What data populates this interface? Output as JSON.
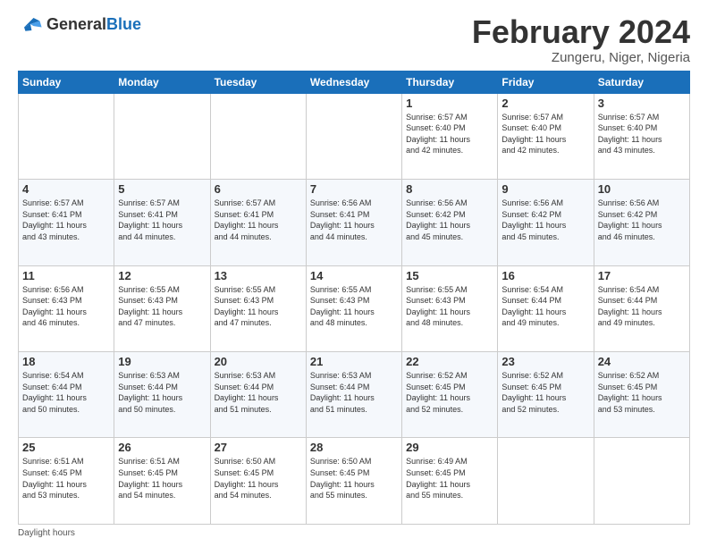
{
  "header": {
    "logo_general": "General",
    "logo_blue": "Blue",
    "title": "February 2024",
    "subtitle": "Zungeru, Niger, Nigeria"
  },
  "days_of_week": [
    "Sunday",
    "Monday",
    "Tuesday",
    "Wednesday",
    "Thursday",
    "Friday",
    "Saturday"
  ],
  "weeks": [
    {
      "days": [
        {
          "number": "",
          "info": ""
        },
        {
          "number": "",
          "info": ""
        },
        {
          "number": "",
          "info": ""
        },
        {
          "number": "",
          "info": ""
        },
        {
          "number": "1",
          "info": "Sunrise: 6:57 AM\nSunset: 6:40 PM\nDaylight: 11 hours\nand 42 minutes."
        },
        {
          "number": "2",
          "info": "Sunrise: 6:57 AM\nSunset: 6:40 PM\nDaylight: 11 hours\nand 42 minutes."
        },
        {
          "number": "3",
          "info": "Sunrise: 6:57 AM\nSunset: 6:40 PM\nDaylight: 11 hours\nand 43 minutes."
        }
      ]
    },
    {
      "days": [
        {
          "number": "4",
          "info": "Sunrise: 6:57 AM\nSunset: 6:41 PM\nDaylight: 11 hours\nand 43 minutes."
        },
        {
          "number": "5",
          "info": "Sunrise: 6:57 AM\nSunset: 6:41 PM\nDaylight: 11 hours\nand 44 minutes."
        },
        {
          "number": "6",
          "info": "Sunrise: 6:57 AM\nSunset: 6:41 PM\nDaylight: 11 hours\nand 44 minutes."
        },
        {
          "number": "7",
          "info": "Sunrise: 6:56 AM\nSunset: 6:41 PM\nDaylight: 11 hours\nand 44 minutes."
        },
        {
          "number": "8",
          "info": "Sunrise: 6:56 AM\nSunset: 6:42 PM\nDaylight: 11 hours\nand 45 minutes."
        },
        {
          "number": "9",
          "info": "Sunrise: 6:56 AM\nSunset: 6:42 PM\nDaylight: 11 hours\nand 45 minutes."
        },
        {
          "number": "10",
          "info": "Sunrise: 6:56 AM\nSunset: 6:42 PM\nDaylight: 11 hours\nand 46 minutes."
        }
      ]
    },
    {
      "days": [
        {
          "number": "11",
          "info": "Sunrise: 6:56 AM\nSunset: 6:43 PM\nDaylight: 11 hours\nand 46 minutes."
        },
        {
          "number": "12",
          "info": "Sunrise: 6:55 AM\nSunset: 6:43 PM\nDaylight: 11 hours\nand 47 minutes."
        },
        {
          "number": "13",
          "info": "Sunrise: 6:55 AM\nSunset: 6:43 PM\nDaylight: 11 hours\nand 47 minutes."
        },
        {
          "number": "14",
          "info": "Sunrise: 6:55 AM\nSunset: 6:43 PM\nDaylight: 11 hours\nand 48 minutes."
        },
        {
          "number": "15",
          "info": "Sunrise: 6:55 AM\nSunset: 6:43 PM\nDaylight: 11 hours\nand 48 minutes."
        },
        {
          "number": "16",
          "info": "Sunrise: 6:54 AM\nSunset: 6:44 PM\nDaylight: 11 hours\nand 49 minutes."
        },
        {
          "number": "17",
          "info": "Sunrise: 6:54 AM\nSunset: 6:44 PM\nDaylight: 11 hours\nand 49 minutes."
        }
      ]
    },
    {
      "days": [
        {
          "number": "18",
          "info": "Sunrise: 6:54 AM\nSunset: 6:44 PM\nDaylight: 11 hours\nand 50 minutes."
        },
        {
          "number": "19",
          "info": "Sunrise: 6:53 AM\nSunset: 6:44 PM\nDaylight: 11 hours\nand 50 minutes."
        },
        {
          "number": "20",
          "info": "Sunrise: 6:53 AM\nSunset: 6:44 PM\nDaylight: 11 hours\nand 51 minutes."
        },
        {
          "number": "21",
          "info": "Sunrise: 6:53 AM\nSunset: 6:44 PM\nDaylight: 11 hours\nand 51 minutes."
        },
        {
          "number": "22",
          "info": "Sunrise: 6:52 AM\nSunset: 6:45 PM\nDaylight: 11 hours\nand 52 minutes."
        },
        {
          "number": "23",
          "info": "Sunrise: 6:52 AM\nSunset: 6:45 PM\nDaylight: 11 hours\nand 52 minutes."
        },
        {
          "number": "24",
          "info": "Sunrise: 6:52 AM\nSunset: 6:45 PM\nDaylight: 11 hours\nand 53 minutes."
        }
      ]
    },
    {
      "days": [
        {
          "number": "25",
          "info": "Sunrise: 6:51 AM\nSunset: 6:45 PM\nDaylight: 11 hours\nand 53 minutes."
        },
        {
          "number": "26",
          "info": "Sunrise: 6:51 AM\nSunset: 6:45 PM\nDaylight: 11 hours\nand 54 minutes."
        },
        {
          "number": "27",
          "info": "Sunrise: 6:50 AM\nSunset: 6:45 PM\nDaylight: 11 hours\nand 54 minutes."
        },
        {
          "number": "28",
          "info": "Sunrise: 6:50 AM\nSunset: 6:45 PM\nDaylight: 11 hours\nand 55 minutes."
        },
        {
          "number": "29",
          "info": "Sunrise: 6:49 AM\nSunset: 6:45 PM\nDaylight: 11 hours\nand 55 minutes."
        },
        {
          "number": "",
          "info": ""
        },
        {
          "number": "",
          "info": ""
        }
      ]
    }
  ],
  "footer": {
    "note": "Daylight hours"
  }
}
